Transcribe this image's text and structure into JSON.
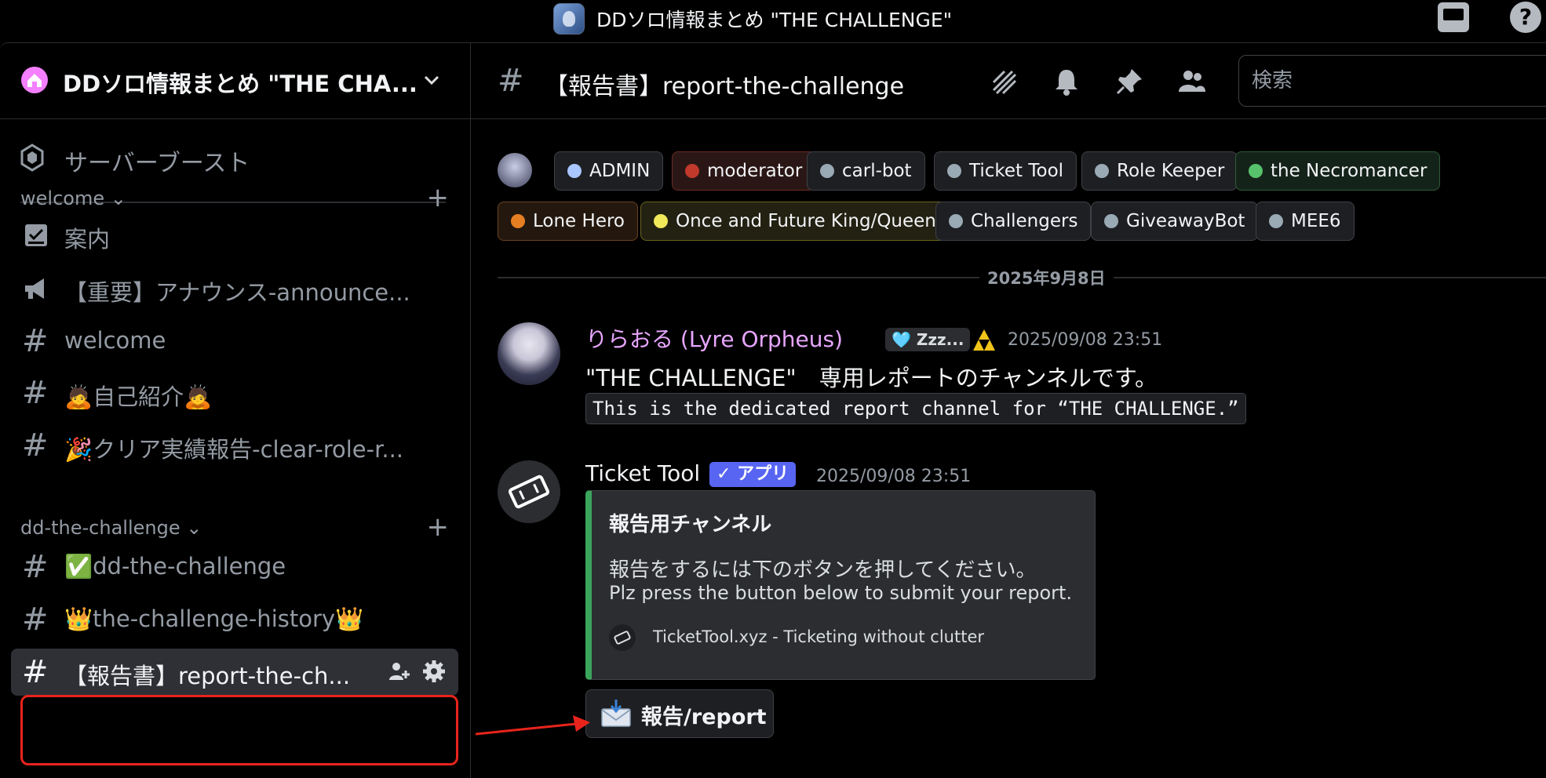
{
  "window": {
    "title": "DDソロ情報まとめ \"THE CHALLENGE\""
  },
  "sidebar": {
    "server_name": "DDソロ情報まとめ \"THE CHA...",
    "boost_label": "サーバーブースト",
    "categories": [
      {
        "label": "welcome",
        "channels": [
          {
            "label": "案内",
            "icon": "rules-icon"
          },
          {
            "label": "【重要】アナウンス-announce...",
            "icon": "announcement-icon"
          },
          {
            "label": "welcome",
            "icon": "hash-icon"
          },
          {
            "label": "🙇自己紹介🙇",
            "icon": "hash-icon"
          },
          {
            "label": "🎉クリア実績報告-clear-role-r...",
            "icon": "locked-hash-icon"
          }
        ]
      },
      {
        "label": "dd-the-challenge",
        "channels": [
          {
            "label": "✅dd-the-challenge",
            "icon": "locked-hash-icon"
          },
          {
            "label": "👑the-challenge-history👑",
            "icon": "locked-hash-icon"
          },
          {
            "label": "【報告書】report-the-ch...",
            "icon": "locked-hash-icon",
            "active": true
          }
        ]
      }
    ]
  },
  "header": {
    "channel_name": "【報告書】report-the-challenge",
    "search_placeholder": "検索"
  },
  "roles": [
    {
      "label": "ADMIN",
      "color": "#a9c6ff"
    },
    {
      "label": "moderator",
      "color": "#c0392b"
    },
    {
      "label": "carl-bot",
      "color": "#99aab5"
    },
    {
      "label": "Ticket Tool",
      "color": "#99aab5"
    },
    {
      "label": "Role Keeper",
      "color": "#99aab5"
    },
    {
      "label": "the Necromancer",
      "color": "#57c26b"
    },
    {
      "label": "Lone Hero",
      "color": "#e67e22"
    },
    {
      "label": "Once and Future King/Queen",
      "color": "#f1e85a"
    },
    {
      "label": "Challengers",
      "color": "#99aab5"
    },
    {
      "label": "GiveawayBot",
      "color": "#99aab5"
    },
    {
      "label": "MEE6",
      "color": "#99aab5"
    }
  ],
  "date_divider": "2025年9月8日",
  "messages": [
    {
      "author": "りらおる (Lyre Orpheus)",
      "author_color": "#e7a6ff",
      "badge": "🩵 Zzz...",
      "timestamp": "2025/09/08 23:51",
      "text": "\"THE CHALLENGE\"　専用レポートのチャンネルです。",
      "code": "This is the dedicated report channel for “THE CHALLENGE.”"
    },
    {
      "author": "Ticket Tool",
      "app_badge": "✓ アプリ",
      "timestamp": "2025/09/08 23:51",
      "embed": {
        "title": "報告用チャンネル",
        "desc_jp": "報告をするには下のボタンを押してください。",
        "desc_en": "Plz press the button below to submit your report.",
        "footer": "TicketTool.xyz - Ticketing without clutter",
        "accent": "#3ba55c"
      },
      "button_label": "報告/report"
    }
  ]
}
